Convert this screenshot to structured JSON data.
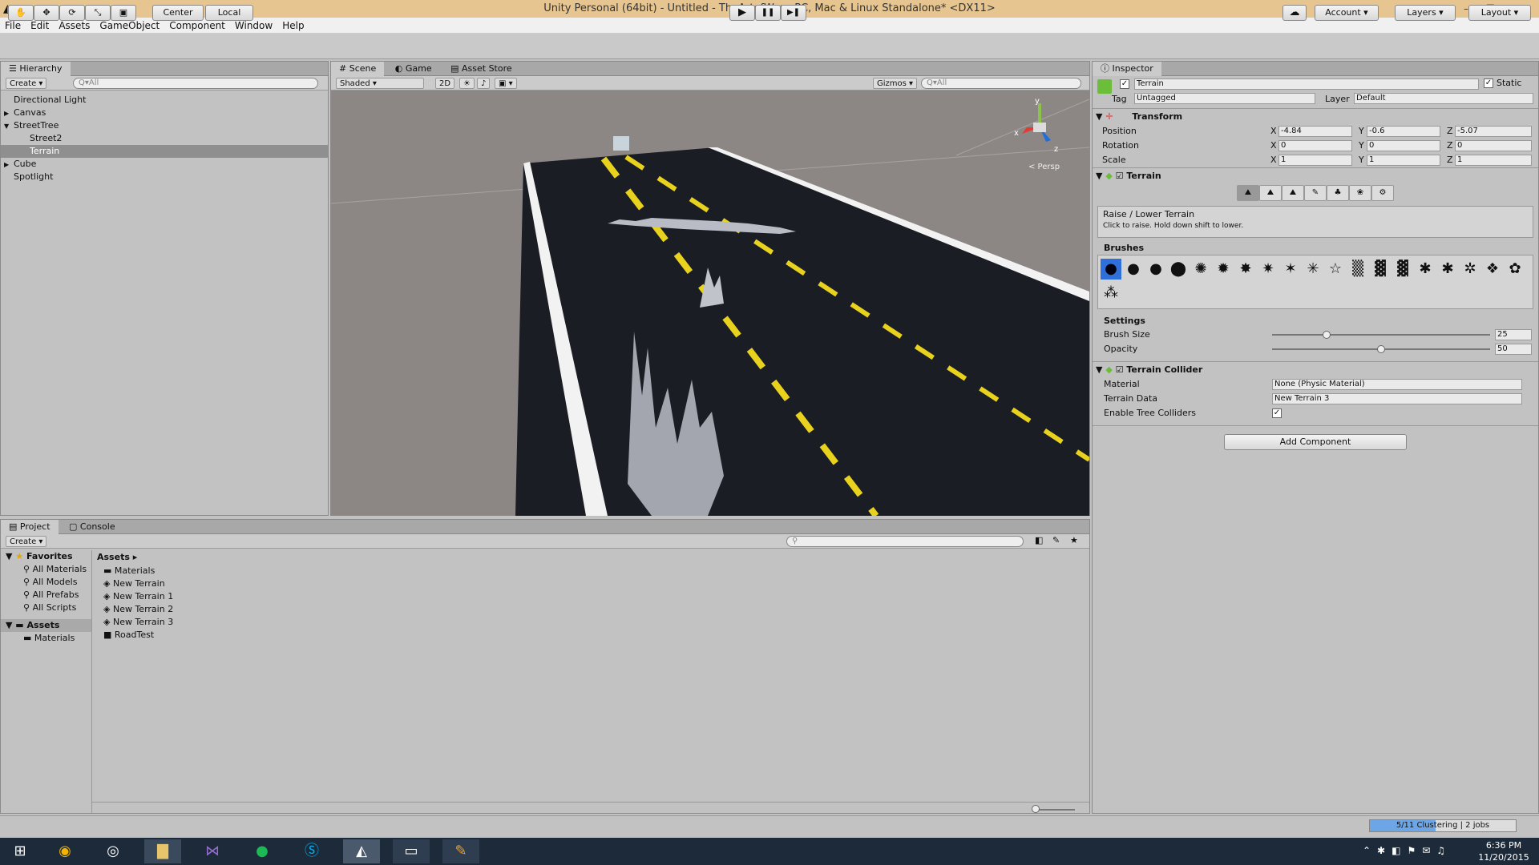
{
  "window": {
    "title": "Unity Personal (64bit) - Untitled - TheArtofWar - PC, Mac & Linux Standalone* <DX11>",
    "minimize": "–",
    "maximize": "❐",
    "close": "✕"
  },
  "menu": [
    "File",
    "Edit",
    "Assets",
    "GameObject",
    "Component",
    "Window",
    "Help"
  ],
  "toolbar": {
    "tools": [
      "hand-icon",
      "move-icon",
      "rotate-icon",
      "scale-icon",
      "rect-icon"
    ],
    "tool_glyphs": [
      "✋",
      "✥",
      "⟳",
      "⤡",
      "▣"
    ],
    "center_label": "Center",
    "local_label": "Local",
    "play": "▶",
    "pause": "❚❚",
    "step": "▶❚",
    "cloud": "☁",
    "account_label": "Account",
    "layers_label": "Layers",
    "layout_label": "Layout"
  },
  "hierarchy": {
    "tab_label": "Hierarchy",
    "create_label": "Create",
    "search_placeholder": "Q▾All",
    "items": [
      {
        "label": "Directional Light",
        "arrow": "",
        "indent": 0
      },
      {
        "label": "Canvas",
        "arrow": "▶",
        "indent": 0
      },
      {
        "label": "StreetTree",
        "arrow": "▼",
        "indent": 0
      },
      {
        "label": "Street2",
        "arrow": "",
        "indent": 1
      },
      {
        "label": "Terrain",
        "arrow": "",
        "indent": 1,
        "selected": true
      },
      {
        "label": "Cube",
        "arrow": "▶",
        "indent": 0
      },
      {
        "label": "Spotlight",
        "arrow": "",
        "indent": 0
      }
    ]
  },
  "scene": {
    "tabs": [
      "Scene",
      "Game",
      "Asset Store"
    ],
    "shading": "Shaded",
    "mode_2d": "2D",
    "gizmos_label": "Gizmos",
    "search_placeholder": "Q▾All",
    "persp_label": "< Persp",
    "axis_y": "y",
    "axis_x": "x",
    "axis_z": "z"
  },
  "inspector": {
    "tab_label": "Inspector",
    "object_name": "Terrain",
    "static_label": "Static",
    "tag_label": "Tag",
    "tag_value": "Untagged",
    "layer_label": "Layer",
    "layer_value": "Default",
    "transform": {
      "title": "Transform",
      "position_label": "Position",
      "position": [
        "-4.84",
        "-0.6",
        "-5.07"
      ],
      "rotation_label": "Rotation",
      "rotation": [
        "0",
        "0",
        "0"
      ],
      "scale_label": "Scale",
      "scale": [
        "1",
        "1",
        "1"
      ]
    },
    "terrain": {
      "title": "Terrain",
      "tool_title": "Raise / Lower Terrain",
      "tool_help": "Click to raise. Hold down shift to lower.",
      "brushes_label": "Brushes",
      "brush_glyphs": [
        "●",
        "●",
        "●",
        "⬤",
        "✺",
        "✹",
        "✸",
        "✷",
        "✶",
        "✳",
        "☆",
        "▒",
        "▓",
        "▓",
        "✱",
        "✱",
        "✲",
        "❖",
        "✿",
        "⁂"
      ],
      "settings_label": "Settings",
      "brush_size_label": "Brush Size",
      "brush_size": "25",
      "opacity_label": "Opacity",
      "opacity": "50",
      "brush_size_fraction": 0.25,
      "opacity_fraction": 0.5
    },
    "collider": {
      "title": "Terrain Collider",
      "material_label": "Material",
      "material_value": "None (Physic Material)",
      "data_label": "Terrain Data",
      "data_value": "New Terrain 3",
      "trees_label": "Enable Tree Colliders"
    },
    "add_component_label": "Add Component"
  },
  "project": {
    "tabs": [
      "Project",
      "Console"
    ],
    "create_label": "Create",
    "favorites_label": "Favorites",
    "favorites": [
      "All Materials",
      "All Models",
      "All Prefabs",
      "All Scripts"
    ],
    "assets_label": "Assets",
    "tree_materials": "Materials",
    "breadcrumb": "Assets",
    "files": [
      "Materials",
      "New Terrain",
      "New Terrain 1",
      "New Terrain 2",
      "New Terrain 3",
      "RoadTest"
    ]
  },
  "status": {
    "progress_text": "5/11 Clustering | 2 jobs",
    "progress_fraction": 0.45
  },
  "taskbar": {
    "time": "6:36 PM",
    "date": "11/20/2015"
  }
}
